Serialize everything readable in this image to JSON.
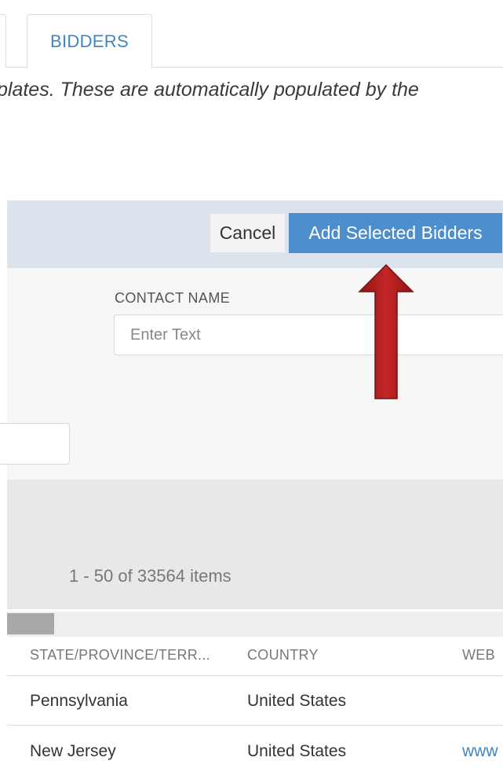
{
  "tabs": {
    "active_label": "BIDDERS"
  },
  "intro_text": "plates. These are automatically populated by the",
  "dialog": {
    "cancel_label": "Cancel",
    "add_label": "Add Selected Bidders",
    "contact_name_label": "CONTACT NAME",
    "contact_name_placeholder": "Enter Text"
  },
  "results": {
    "count_text": "1 - 50 of 33564 items"
  },
  "table": {
    "columns": [
      "STATE/PROVINCE/TERR...",
      "COUNTRY",
      "WEB"
    ],
    "rows": [
      {
        "state": "Pennsylvania",
        "country": "United States",
        "web": ""
      },
      {
        "state": "New Jersey",
        "country": "United States",
        "web": "www"
      }
    ]
  },
  "colors": {
    "accent": "#4d8fcc",
    "tab_text": "#3f86c2",
    "arrow": "#b01e1e",
    "header_band": "#dce3ec"
  },
  "icons": {
    "annotation": "red-up-arrow"
  }
}
